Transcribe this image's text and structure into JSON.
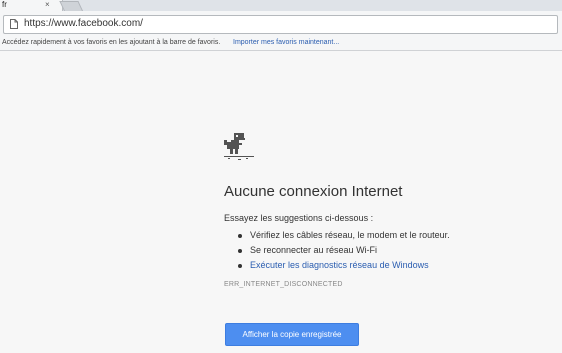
{
  "browser": {
    "tab": {
      "title": "fr",
      "close_glyph": "×"
    },
    "url": "https://www.facebook.com/",
    "bookmarks_bar": {
      "text": "Accédez rapidement à vos favoris en les ajoutant à la barre de favoris.",
      "link": "Importer mes favoris maintenant..."
    }
  },
  "error_page": {
    "icon": "offline-dinosaur-icon",
    "title": "Aucune connexion Internet",
    "intro": "Essayez les suggestions ci-dessous :",
    "suggestions": [
      "Vérifiez les câbles réseau, le modem et le routeur.",
      "Se reconnecter au réseau Wi-Fi",
      "Exécuter les diagnostics réseau de Windows"
    ],
    "error_code": "ERR_INTERNET_DISCONNECTED",
    "button_label": "Afficher la copie enregistrée"
  },
  "colors": {
    "accent": "#4d8ef0",
    "link": "#2a5db0",
    "background": "#f7f7f7"
  }
}
